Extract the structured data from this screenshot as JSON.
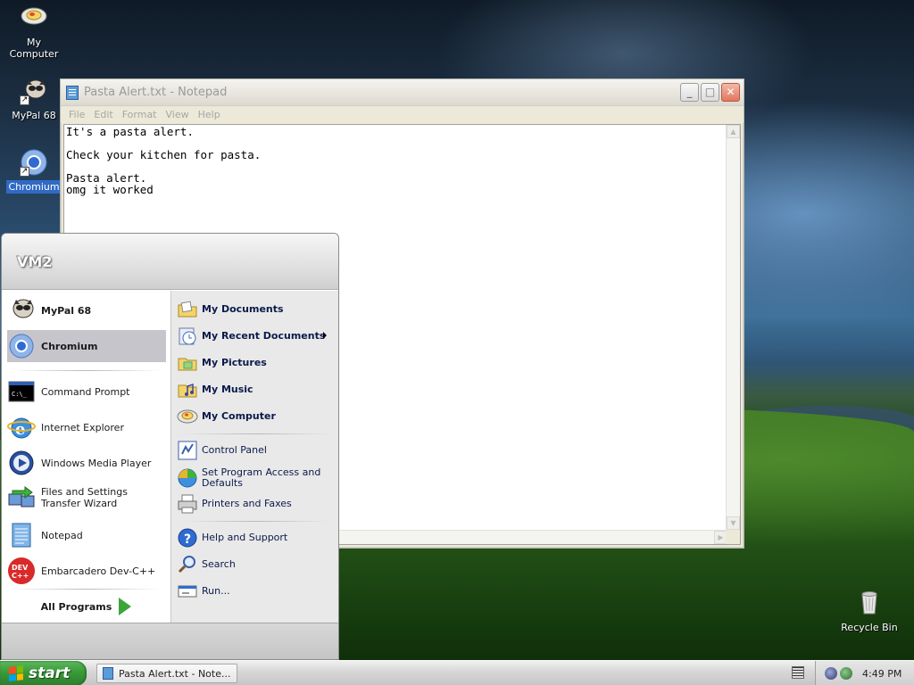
{
  "desktop": {
    "icons": [
      {
        "label": "My Computer"
      },
      {
        "label": "MyPal 68"
      },
      {
        "label": "Chromium"
      },
      {
        "label": "Recycle Bin"
      }
    ]
  },
  "notepad": {
    "title": "Pasta Alert.txt - Notepad",
    "menu": [
      "File",
      "Edit",
      "Format",
      "View",
      "Help"
    ],
    "controls": {
      "minimize": "_",
      "maximize": "□",
      "close": "✕"
    },
    "content": "It's a pasta alert.\n\nCheck your kitchen for pasta.\n\nPasta alert.\nomg it worked"
  },
  "start_menu": {
    "user_name": "VM2",
    "pinned": [
      {
        "label": "MyPal 68",
        "icon": "raccoon-icon"
      },
      {
        "label": "Chromium",
        "icon": "chromium-icon"
      }
    ],
    "recent": [
      {
        "label": "Command Prompt",
        "icon": "cmd-icon"
      },
      {
        "label": "Internet Explorer",
        "icon": "ie-icon"
      },
      {
        "label": "Windows Media Player",
        "icon": "media-player-icon"
      },
      {
        "label": "Files and Settings Transfer Wizard",
        "icon": "transfer-wizard-icon"
      },
      {
        "label": "Notepad",
        "icon": "notepad-icon"
      },
      {
        "label": "Embarcadero Dev-C++",
        "icon": "devcpp-icon"
      }
    ],
    "all_programs": "All Programs",
    "places": [
      {
        "label": "My Documents",
        "icon": "my-documents-icon"
      },
      {
        "label": "My Recent Documents",
        "icon": "recent-documents-icon"
      },
      {
        "label": "My Pictures",
        "icon": "my-pictures-icon"
      },
      {
        "label": "My Music",
        "icon": "my-music-icon"
      },
      {
        "label": "My Computer",
        "icon": "my-computer-icon"
      }
    ],
    "settings": [
      {
        "label": "Control Panel",
        "icon": "control-panel-icon"
      },
      {
        "label": "Set Program Access and Defaults",
        "icon": "program-access-icon"
      },
      {
        "label": "Printers and Faxes",
        "icon": "printer-icon"
      }
    ],
    "help": [
      {
        "label": "Help and Support",
        "icon": "help-icon"
      },
      {
        "label": "Search",
        "icon": "search-icon"
      },
      {
        "label": "Run...",
        "icon": "run-icon"
      }
    ]
  },
  "taskbar": {
    "start_label": "start",
    "task_label": "Pasta Alert.txt - Note...",
    "clock": "4:49 PM"
  },
  "colors": {
    "selection": "#316ac5",
    "start_green": "#3a9a3a",
    "highlight_item": "#c5c5cb"
  }
}
